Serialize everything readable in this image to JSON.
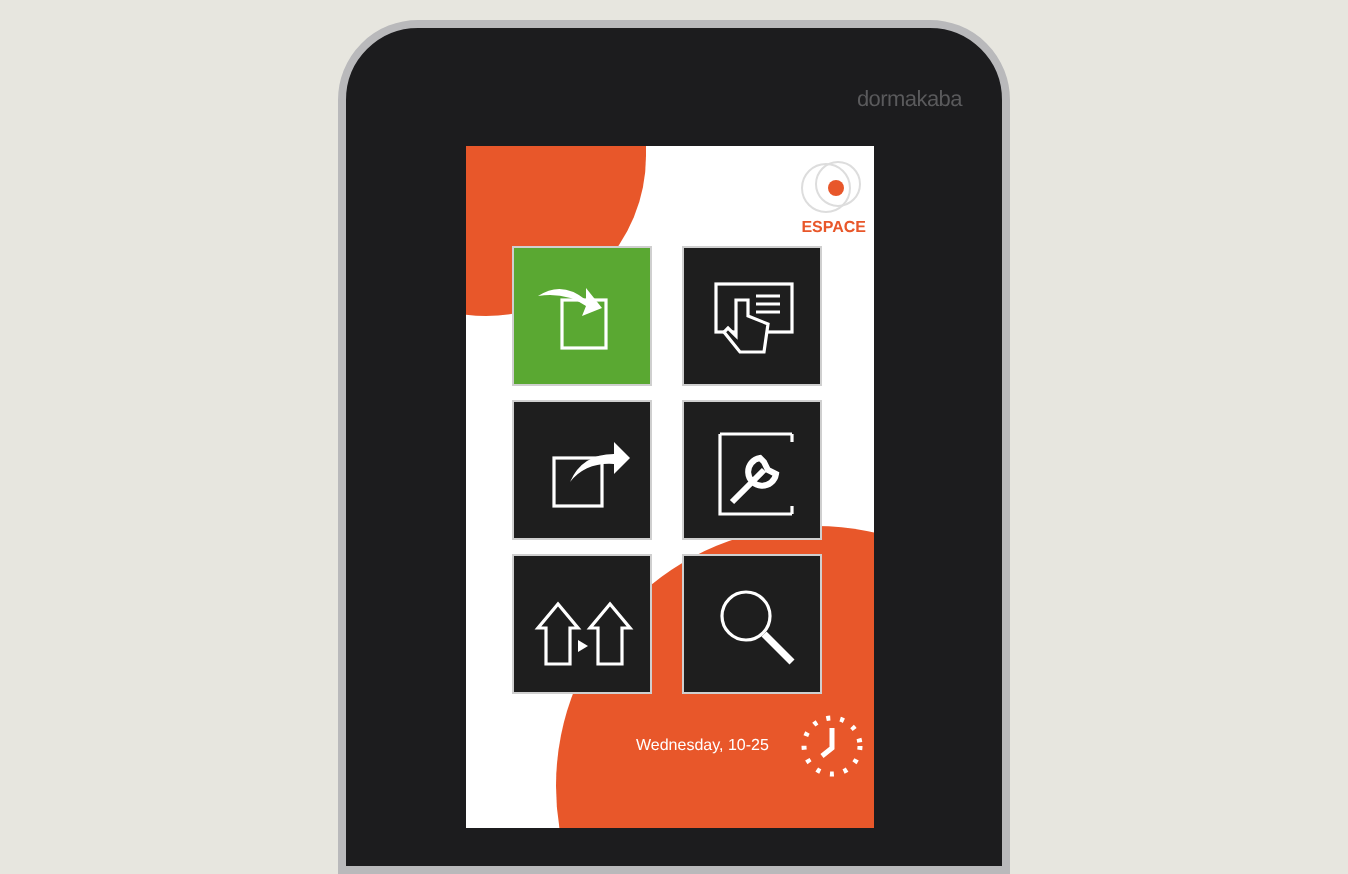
{
  "device": {
    "brand": "dormakaba"
  },
  "screen": {
    "logo_text": "ESPACE",
    "tiles": [
      {
        "kind": "enter",
        "selected": true
      },
      {
        "kind": "touch",
        "selected": false
      },
      {
        "kind": "exit",
        "selected": false
      },
      {
        "kind": "service",
        "selected": false
      },
      {
        "kind": "transfer",
        "selected": false
      },
      {
        "kind": "search",
        "selected": false
      }
    ],
    "date": "Wednesday, 10-25"
  }
}
